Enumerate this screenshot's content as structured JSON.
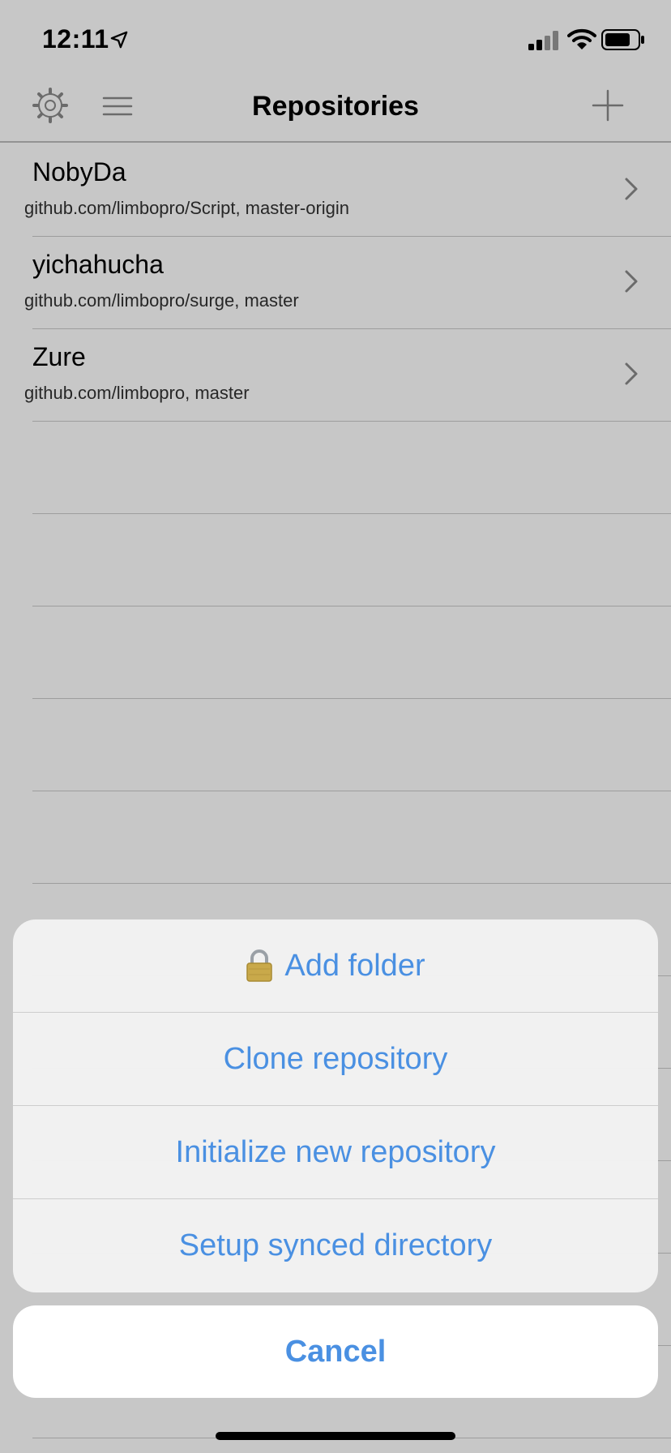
{
  "status": {
    "time": "12:11"
  },
  "nav": {
    "title": "Repositories"
  },
  "repos": [
    {
      "name": "NobyDa",
      "subtitle": "github.com/limbopro/Script, master-origin"
    },
    {
      "name": "yichahucha",
      "subtitle": "github.com/limbopro/surge, master"
    },
    {
      "name": "Zure",
      "subtitle": "github.com/limbopro, master"
    }
  ],
  "action_sheet": {
    "add_folder": "Add folder",
    "clone": "Clone repository",
    "init": "Initialize new repository",
    "setup_synced": "Setup synced directory",
    "cancel": "Cancel"
  },
  "colors": {
    "accent": "#4a90e2"
  },
  "icons": [
    "gear-icon",
    "menu-icon",
    "plus-icon",
    "chevron-right-icon",
    "lock-icon",
    "location-arrow-icon",
    "signal-icon",
    "wifi-icon",
    "battery-icon"
  ]
}
